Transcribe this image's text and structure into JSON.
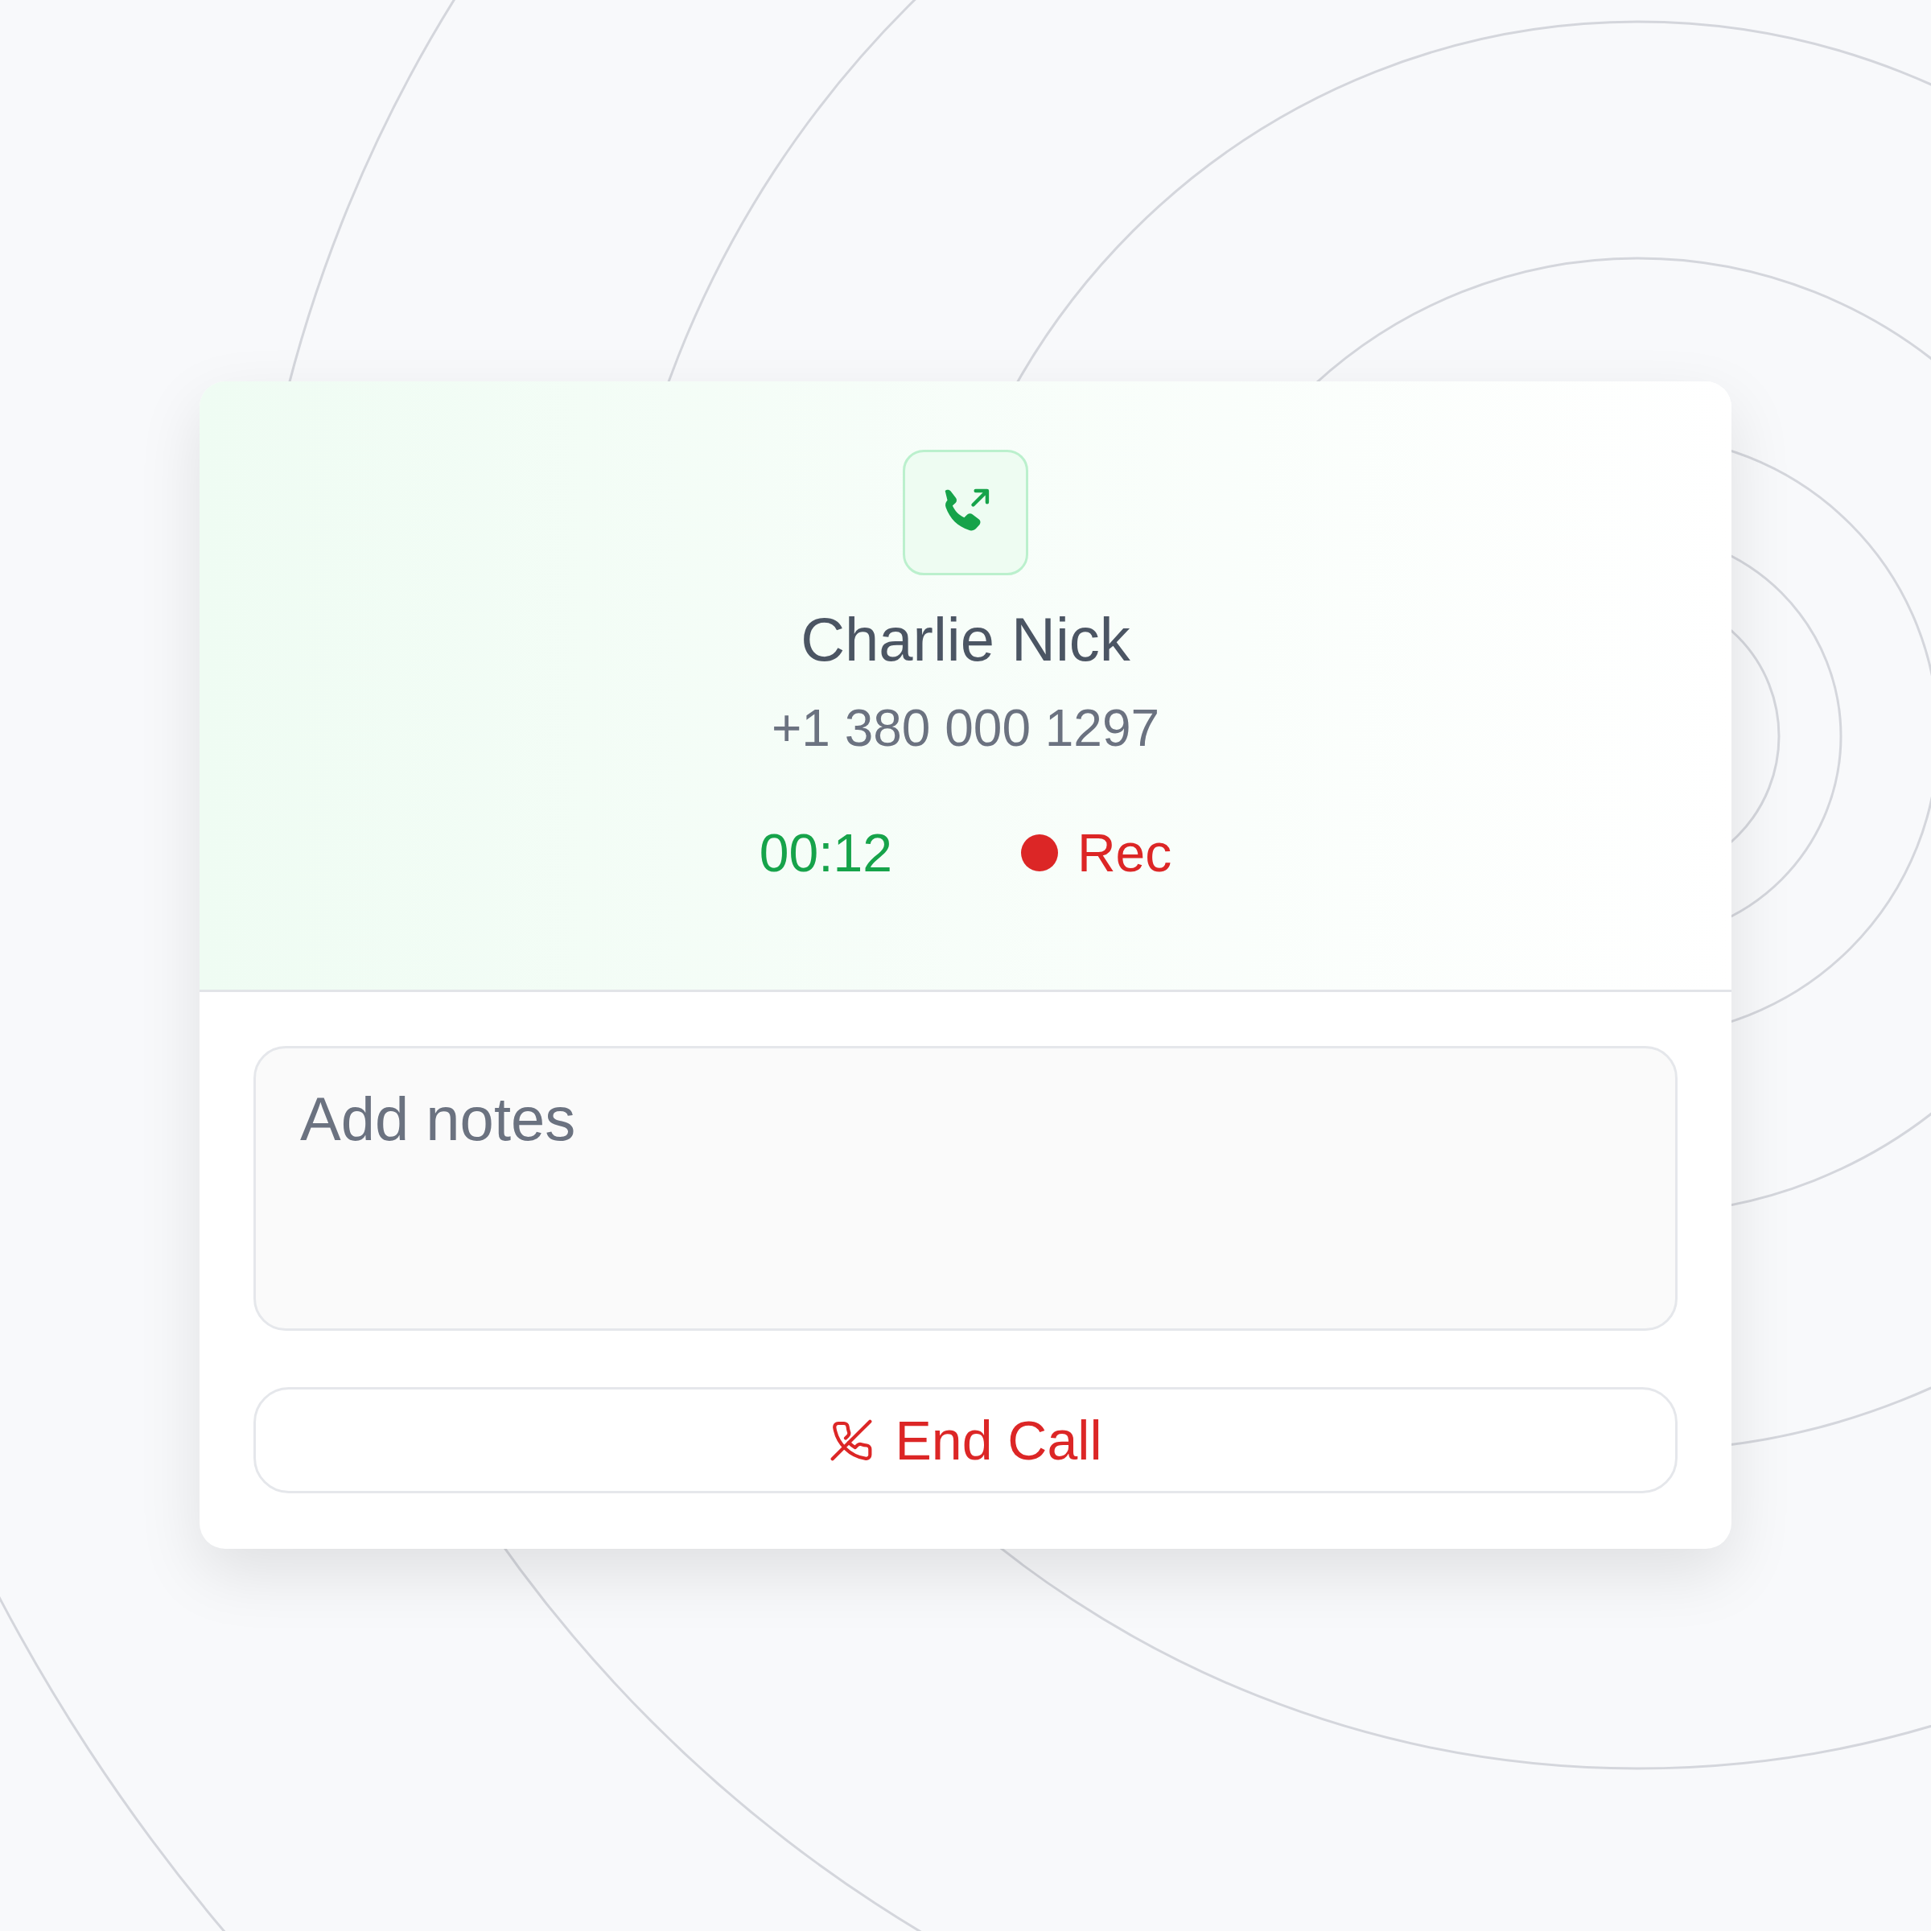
{
  "contact": {
    "name": "Charlie Nick",
    "phone": "+1 380 000 1297"
  },
  "timer": "00:12",
  "recording": {
    "on": true,
    "label": "Rec"
  },
  "notes": {
    "placeholder": "Add notes"
  },
  "end_button": {
    "label": "End Call"
  }
}
